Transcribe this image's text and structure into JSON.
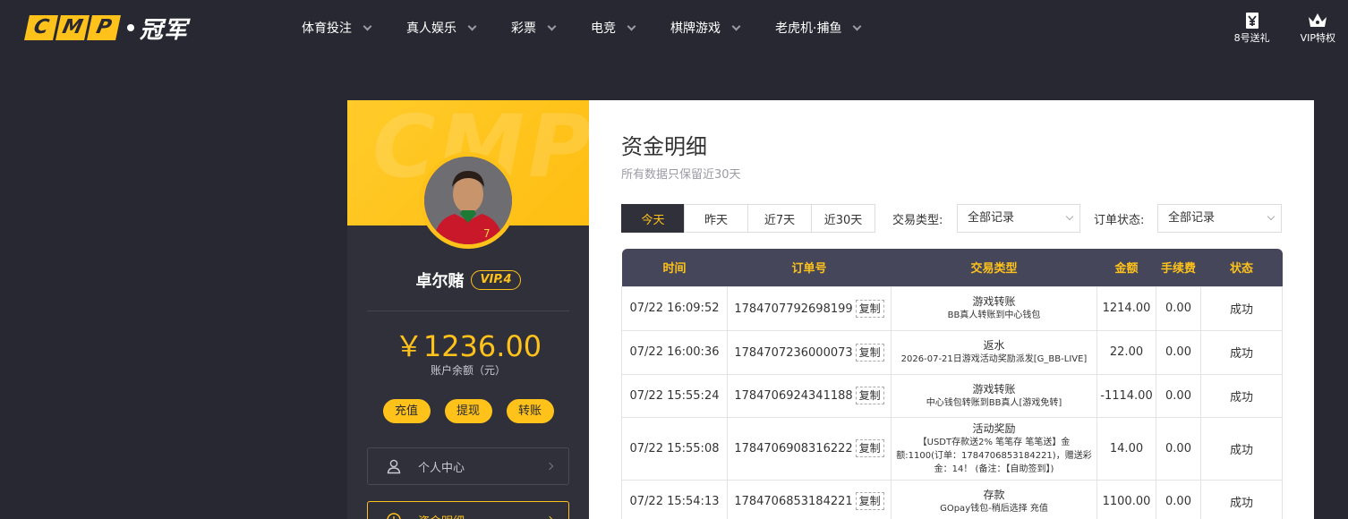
{
  "logo": {
    "letters": [
      "C",
      "M",
      "P"
    ],
    "cn": "冠军"
  },
  "nav": [
    {
      "label": "体育投注"
    },
    {
      "label": "真人娱乐"
    },
    {
      "label": "彩票"
    },
    {
      "label": "电竞"
    },
    {
      "label": "棋牌游戏"
    },
    {
      "label": "老虎机·捕鱼"
    }
  ],
  "top_right": [
    {
      "label": "8号送礼",
      "icon": "gift-ticket-icon"
    },
    {
      "label": "VIP特权",
      "icon": "crown-icon"
    }
  ],
  "profile": {
    "watermark": "CMP",
    "username": "卓尔赌",
    "vip": "VIP.4",
    "balance": "￥1236.00",
    "balance_label": "账户余额（元）",
    "actions": [
      "充值",
      "提现",
      "转账"
    ],
    "menu": [
      {
        "label": "个人中心",
        "icon": "user-icon"
      },
      {
        "label": "资金明细",
        "icon": "clock-icon"
      }
    ]
  },
  "page": {
    "title": "资金明细",
    "subtitle": "所有数据只保留近30天"
  },
  "filters": {
    "date_tabs": [
      "今天",
      "昨天",
      "近7天",
      "近30天"
    ],
    "active_tab": "今天",
    "type_label": "交易类型:",
    "type_value": "全部记录",
    "status_label": "订单状态:",
    "status_value": "全部记录"
  },
  "table": {
    "headers": [
      "时间",
      "订单号",
      "交易类型",
      "金额",
      "手续费",
      "状态"
    ],
    "copy_label": "复制",
    "rows": [
      {
        "time": "07/22 16:09:52",
        "order": "1784707792698199",
        "type": "游戏转账",
        "desc": "BB真人转账到中心钱包",
        "amount": "1214.00",
        "fee": "0.00",
        "status": "成功"
      },
      {
        "time": "07/22 16:00:36",
        "order": "1784707236000073",
        "type": "返水",
        "desc": "2026-07-21日游戏活动奖励派发[G_BB-LIVE]",
        "amount": "22.00",
        "fee": "0.00",
        "status": "成功"
      },
      {
        "time": "07/22 15:55:24",
        "order": "1784706924341188",
        "type": "游戏转账",
        "desc": "中心钱包转账到BB真人[游戏免转]",
        "amount": "-1114.00",
        "fee": "0.00",
        "status": "成功"
      },
      {
        "time": "07/22 15:55:08",
        "order": "1784706908316222",
        "type": "活动奖励",
        "desc": "【USDT存款送2% 笔笔存 笔笔送】金额:1100(订单：1784706853184221)，赠送彩金：14！ (备注：【自助签到】)",
        "amount": "14.00",
        "fee": "0.00",
        "status": "成功"
      },
      {
        "time": "07/22 15:54:13",
        "order": "1784706853184221",
        "type": "存款",
        "desc": "GOpay钱包-稍后选择 充值",
        "amount": "1100.00",
        "fee": "0.00",
        "status": "成功"
      }
    ]
  }
}
